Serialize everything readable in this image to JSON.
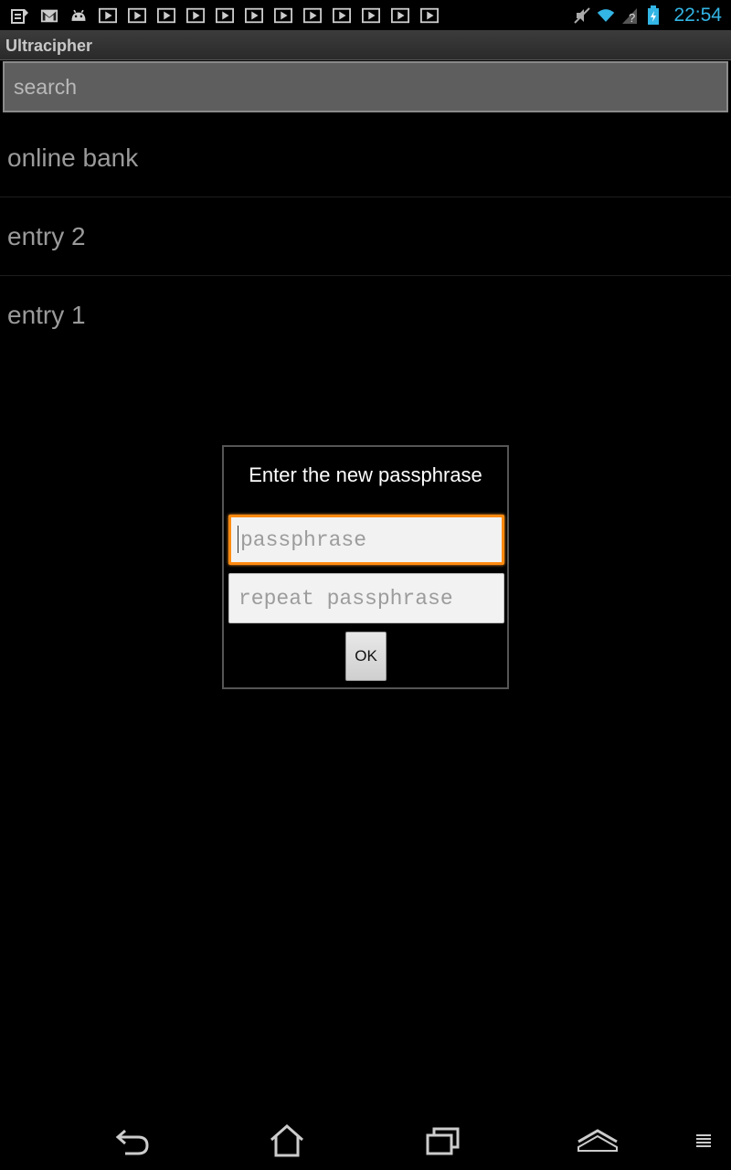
{
  "status_bar": {
    "time": "22:54",
    "left_icons": [
      "notes-icon",
      "gmail-icon",
      "android-debug-icon",
      "play-store-icon",
      "play-store-icon",
      "play-store-icon",
      "play-store-icon",
      "play-store-icon",
      "play-store-icon",
      "play-store-icon",
      "play-store-icon",
      "play-store-icon",
      "play-store-icon",
      "play-store-icon"
    ],
    "right_icons": [
      "mute-icon",
      "wifi-icon",
      "no-signal-icon",
      "battery-charging-icon"
    ],
    "time_color": "#33b5e5"
  },
  "app": {
    "title": "Ultracipher"
  },
  "search": {
    "placeholder": "search"
  },
  "entries": [
    {
      "label": "online bank"
    },
    {
      "label": "entry 2"
    },
    {
      "label": "entry 1"
    }
  ],
  "dialog": {
    "title": "Enter the new passphrase",
    "passphrase_placeholder": "passphrase",
    "repeat_placeholder": "repeat passphrase",
    "ok_label": "OK",
    "focus_color": "#ff8a0f"
  },
  "nav": {
    "icons": [
      "back-icon",
      "home-icon",
      "recent-apps-icon",
      "menu-up-icon",
      "overflow-menu-icon"
    ]
  }
}
